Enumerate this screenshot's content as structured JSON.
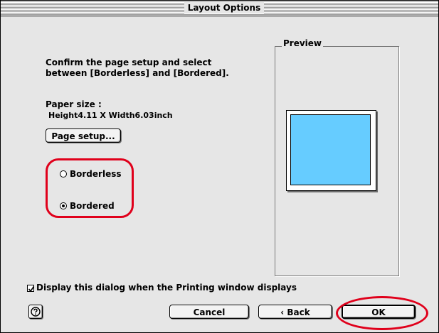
{
  "window": {
    "title": "Layout Options"
  },
  "instructions": {
    "line1": "Confirm the page setup and select",
    "line2": "between [Borderless] and [Bordered]."
  },
  "paper": {
    "label": "Paper size :",
    "value": "Height4.11 X Width6.03inch"
  },
  "buttons": {
    "page_setup": "Page setup...",
    "cancel": "Cancel",
    "back": "‹ Back",
    "ok": "OK"
  },
  "layout": {
    "borderless_label": "Borderless",
    "bordered_label": "Bordered",
    "selected": "Bordered"
  },
  "preview": {
    "label": "Preview",
    "image_color": "#66ccff"
  },
  "display_dialog": {
    "label": "Display this dialog when the Printing window displays",
    "checked": true
  },
  "colors": {
    "highlight_ring": "#e0001b",
    "dialog_bg": "#e6e6e6"
  },
  "icons": {
    "help": "question-mark-icon"
  }
}
